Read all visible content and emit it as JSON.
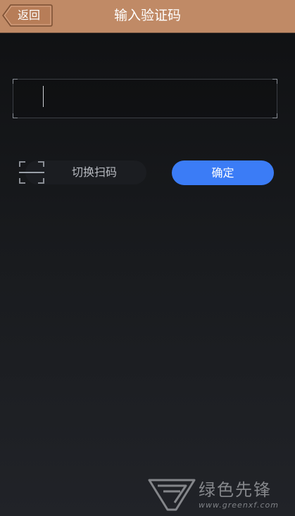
{
  "header": {
    "back_label": "返回",
    "title": "输入验证码",
    "background": "#c08a66"
  },
  "code_input": {
    "value": "",
    "placeholder": ""
  },
  "actions": {
    "switch_scan_label": "切换扫码",
    "confirm_label": "确定",
    "confirm_color": "#3b7cf6"
  },
  "icons": {
    "back": "back-arrow-icon",
    "scan": "scan-frame-icon",
    "watermark_logo": "greenxf-logo-icon"
  },
  "watermark": {
    "name": "绿色先锋",
    "url": "www.greenxf.com"
  }
}
